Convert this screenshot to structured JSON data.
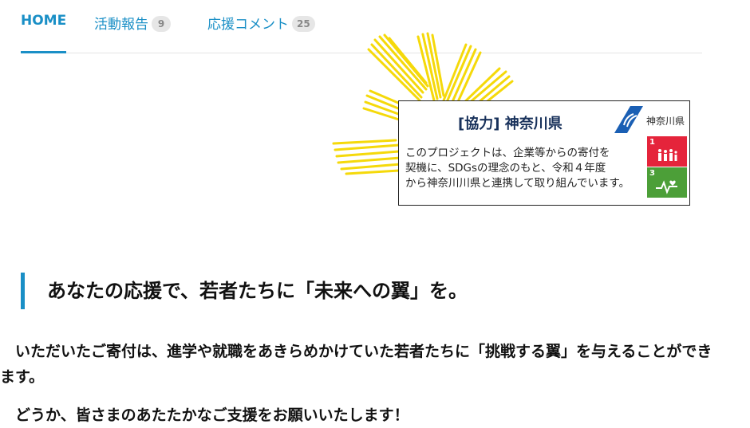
{
  "tabs": [
    {
      "label": "HOME",
      "badge": ""
    },
    {
      "label": "活動報告",
      "badge": "9"
    },
    {
      "label": "応援コメント",
      "badge": "25"
    }
  ],
  "banner": {
    "title": "[協力] 神奈川県",
    "pref_name": "神奈川県",
    "text_lines": [
      "このプロジェクトは、企業等からの寄付を",
      "契機に、SDGsの理念のもと、令和４年度",
      "から神奈川川県と連携して取り組んでいます。"
    ],
    "sdg_goals": [
      "1",
      "3"
    ]
  },
  "heading": "あなたの応援で、若者たちに「未来への翼」を。",
  "paragraphs": [
    "　いただいたご寄付は、進学や就職をあきらめかけていた若者たちに「挑戦する翼」を与えることができます。",
    "　どうか、皆さまのあたたかなご支援をお願いいたします！"
  ],
  "colors": {
    "accent": "#1a8fc6",
    "burst": "#f5d90a",
    "sdg1": "#e5243b",
    "sdg3": "#4c9f38"
  }
}
